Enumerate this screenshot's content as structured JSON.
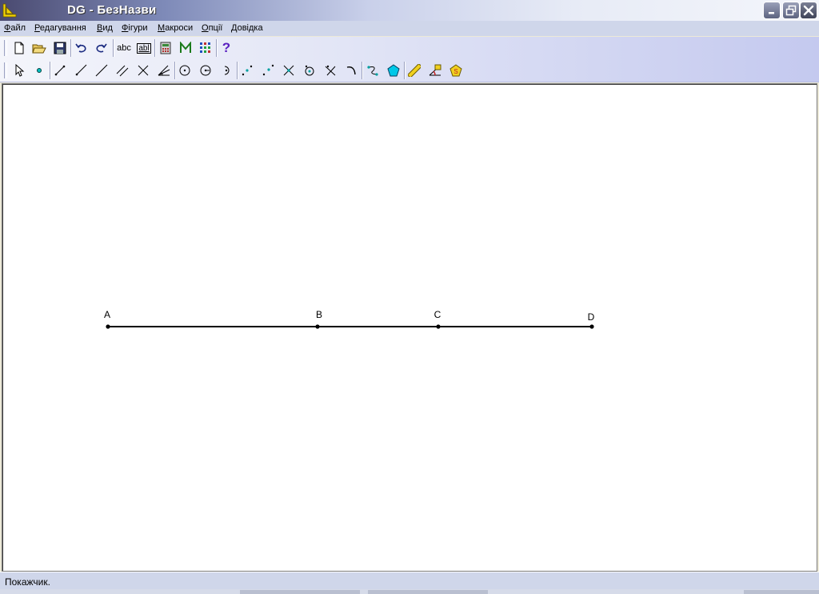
{
  "window": {
    "title": "DG - БезНазви",
    "controls": [
      "minimize-icon",
      "restore-icon",
      "close-icon"
    ]
  },
  "menu": [
    {
      "label": "Файл",
      "accel": "Ф",
      "rest": "айл"
    },
    {
      "label": "Редагування",
      "accel": "Р",
      "rest": "едагування"
    },
    {
      "label": "Вид",
      "accel": "В",
      "rest": "ид"
    },
    {
      "label": "Фігури",
      "accel": "Ф",
      "rest": "ігури"
    },
    {
      "label": "Макроси",
      "accel": "М",
      "rest": "акроси"
    },
    {
      "label": "Опції",
      "accel": "О",
      "rest": "пції"
    },
    {
      "label": "Довідка",
      "accel": "Д",
      "rest": "овідка"
    }
  ],
  "toolbar1": {
    "text_tool": "abc",
    "label_tool": "abl",
    "help": "?"
  },
  "drawing": {
    "segment_color": "#000000",
    "points": [
      "A",
      "B",
      "C",
      "D"
    ]
  },
  "status": {
    "text": "Покажчик."
  }
}
